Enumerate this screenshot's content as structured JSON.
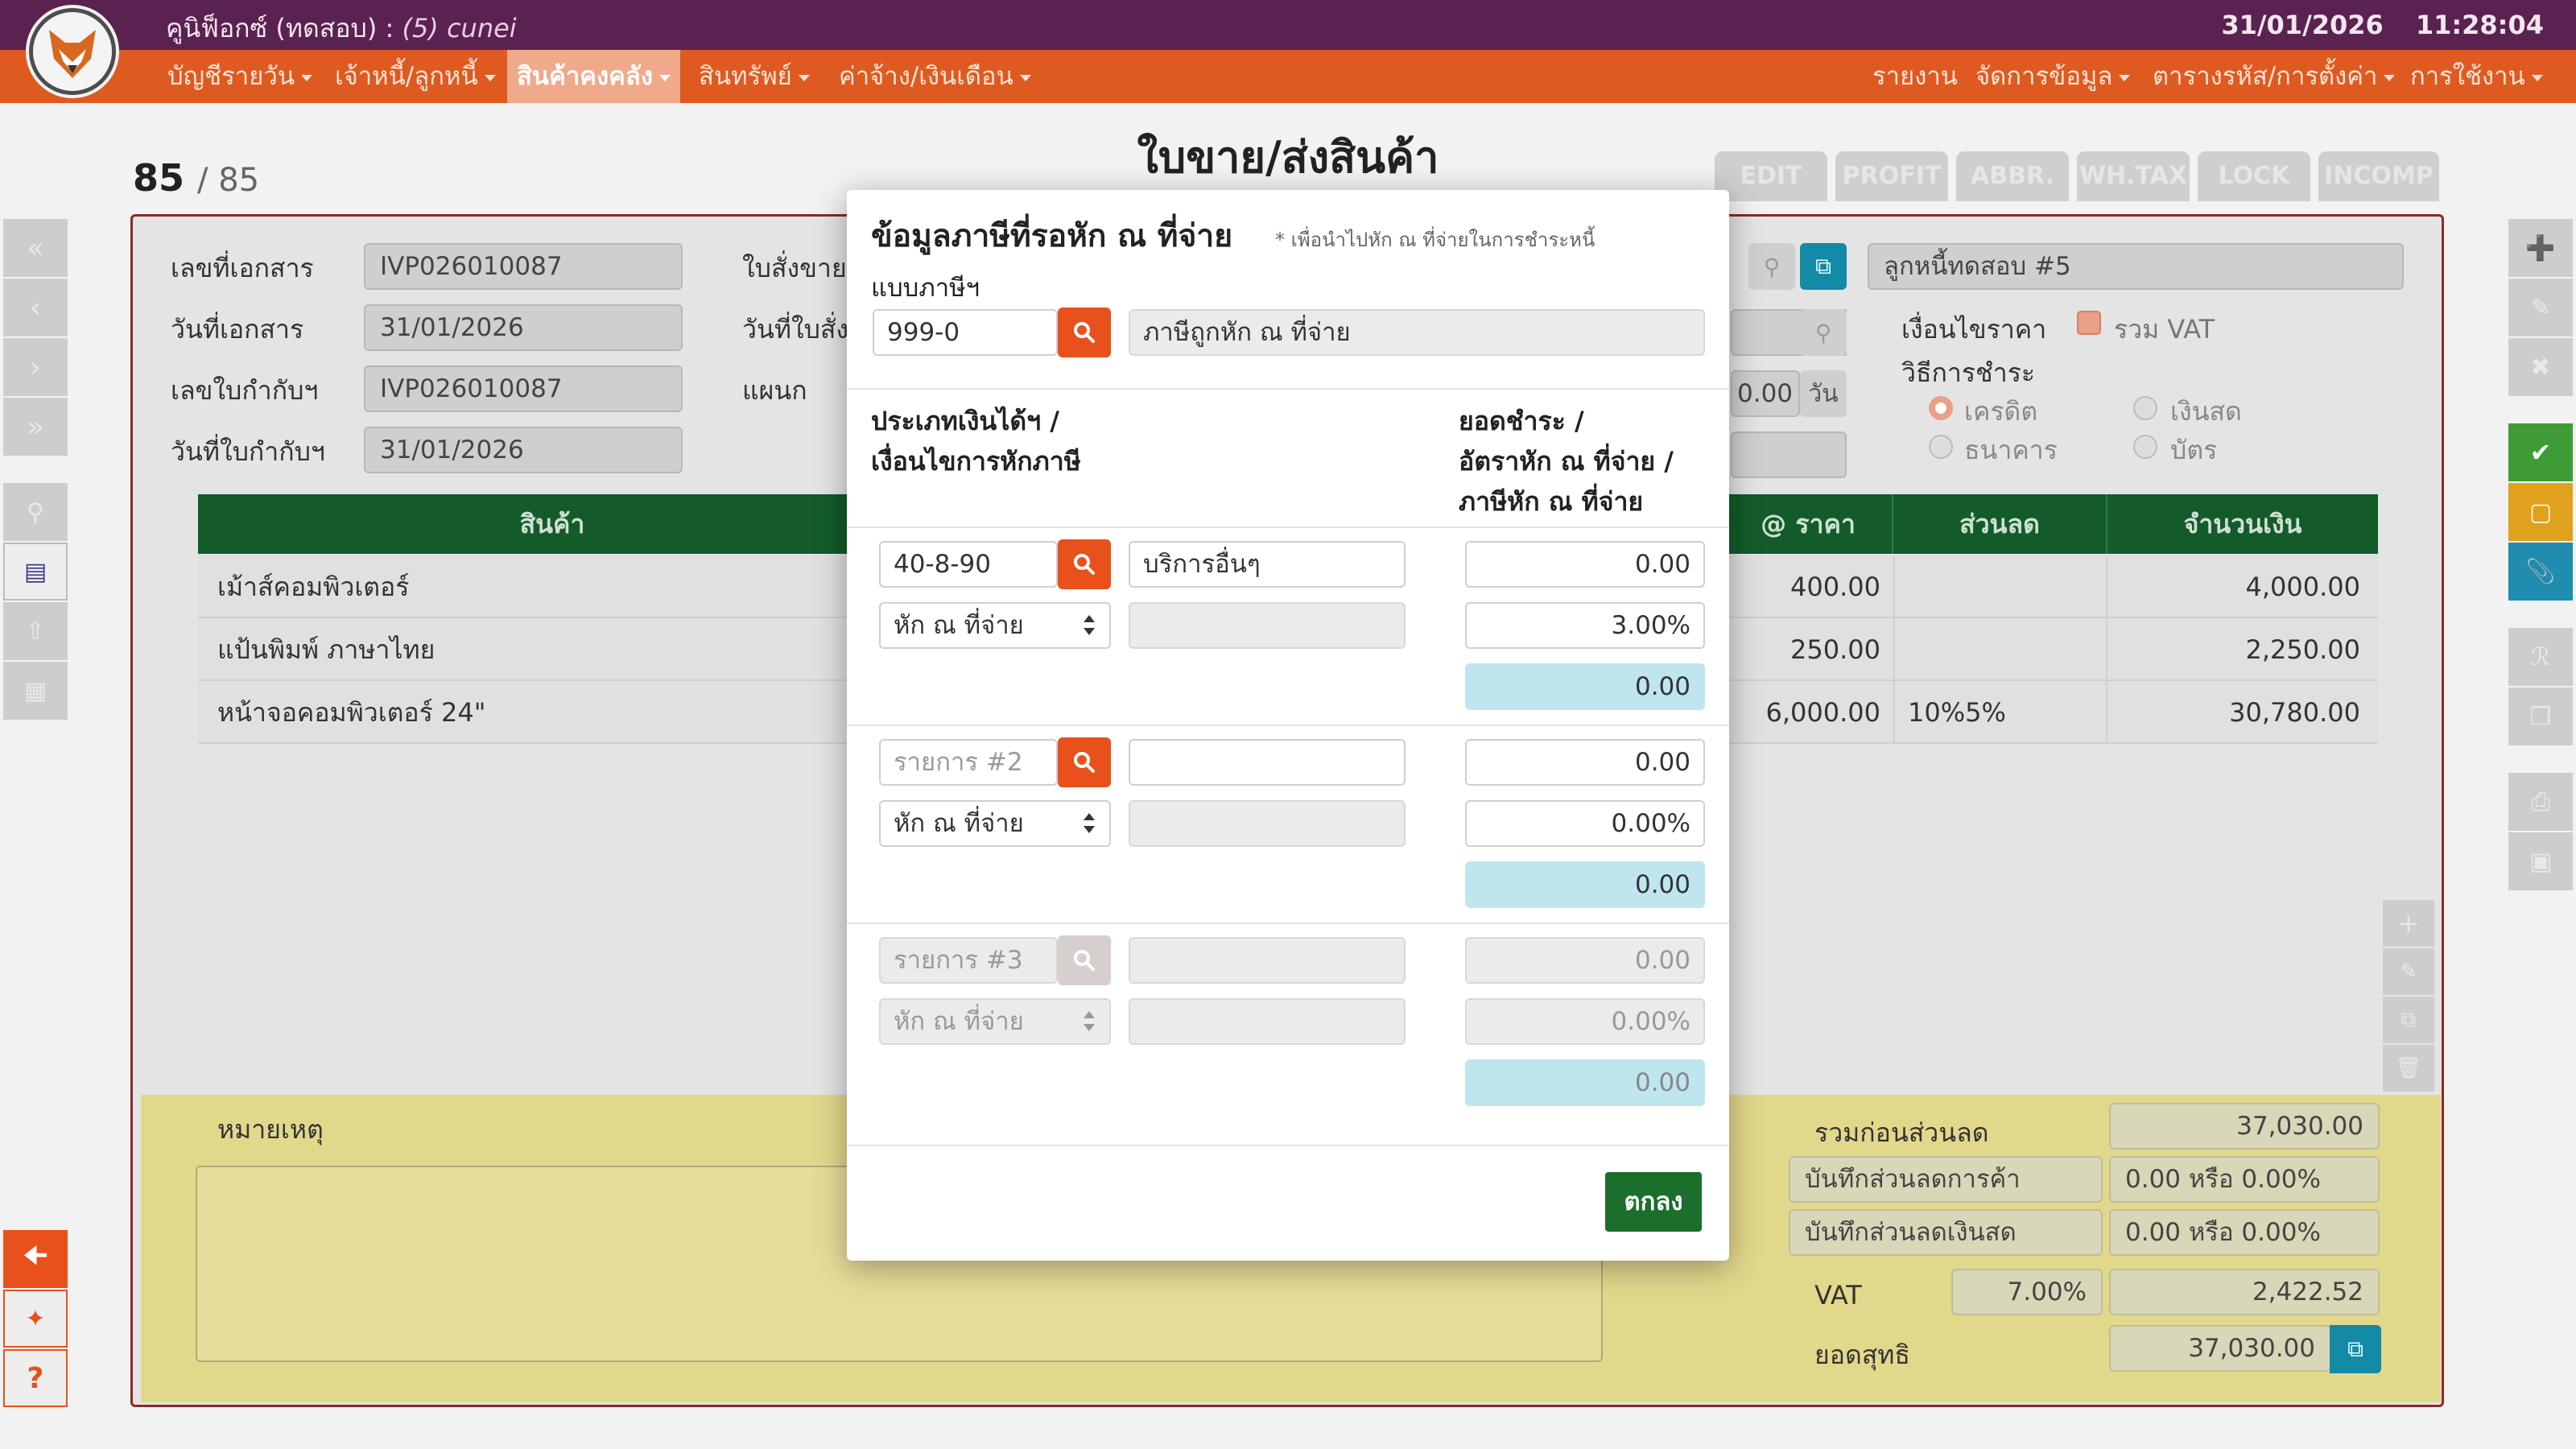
{
  "app": {
    "title": "คูนิฟ็อกซ์ (ทดสอบ)",
    "user_sep": " : ",
    "user": "(5) cunei",
    "date": "31/01/2026",
    "time": "11:28:04"
  },
  "menu": {
    "left": [
      "บัญชีรายวัน",
      "เจ้าหนี้/ลูกหนี้",
      "สินค้าคงคลัง",
      "สินทรัพย์",
      "ค่าจ้าง/เงินเดือน"
    ],
    "right": [
      "รายงาน",
      "จัดการข้อมูล",
      "ตารางรหัส/การตั้งค่า",
      "การใช้งาน"
    ]
  },
  "page": {
    "title": "ใบขาย/ส่งสินค้า",
    "counter": "85",
    "counter_total": "/ 85",
    "tags": [
      "EDIT",
      "PROFIT",
      "ABBR.",
      "WH.TAX",
      "LOCK",
      "INCOMP"
    ]
  },
  "form": {
    "doc_no_label": "เลขที่เอกสาร",
    "doc_no": "IVP026010087",
    "doc_date_label": "วันที่เอกสาร",
    "doc_date": "31/01/2026",
    "tax_no_label": "เลขใบกำกับฯ",
    "tax_no": "IVP026010087",
    "tax_date_label": "วันที่ใบกำกับฯ",
    "tax_date": "31/01/2026",
    "order_label": "ใบสั่งขาย",
    "order_date_label": "วันที่ใบสั่ง",
    "dept_label": "แผนก",
    "credit_days": "0.00",
    "day_unit": "วัน",
    "customer": "ลูกหนี้ทดสอบ #5",
    "price_cond_label": "เงื่อนไขราคา",
    "vat_incl": "รวม VAT",
    "pay_method_label": "วิธีการชำระ",
    "pay_options": [
      "เครดิต",
      "เงินสด",
      "ธนาคาร",
      "บัตร"
    ]
  },
  "table": {
    "headers": {
      "product": "สินค้า",
      "price": "@ ราคา",
      "discount": "ส่วนลด",
      "amount": "จำนวนเงิน"
    },
    "rows": [
      {
        "product": "เม้าส์คอมพิวเตอร์",
        "price": "400.00",
        "discount": "",
        "amount": "4,000.00"
      },
      {
        "product": "แป้นพิมพ์ ภาษาไทย",
        "price": "250.00",
        "discount": "",
        "amount": "2,250.00"
      },
      {
        "product": "หน้าจอคอมพิวเตอร์ 24\"",
        "price": "6,000.00",
        "discount": "10%5%",
        "amount": "30,780.00"
      }
    ]
  },
  "footer": {
    "notes_label": "หมายเหตุ",
    "subtotal_label": "รวมก่อนส่วนลด",
    "subtotal": "37,030.00",
    "trade_disc_label": "บันทึกส่วนลดการค้า",
    "trade_disc": "0.00 หรือ 0.00%",
    "cash_disc_label": "บันทึกส่วนลดเงินสด",
    "cash_disc": "0.00 หรือ 0.00%",
    "vat_label": "VAT",
    "vat_rate": "7.00%",
    "vat_amount": "2,422.52",
    "net_label": "ยอดสุทธิ",
    "net": "37,030.00"
  },
  "modal": {
    "title": "ข้อมูลภาษีที่รอหัก ณ ที่จ่าย",
    "note": "* เพื่อนำไปหัก ณ ที่จ่ายในการชำระหนี้",
    "form_label": "แบบภาษีฯ",
    "form_code": "999-0",
    "form_name": "ภาษีถูกหัก ณ ที่จ่าย",
    "col1_header": [
      "ประเภทเงินได้ฯ /",
      "เงื่อนไขการหักภาษี"
    ],
    "col2_header": [
      "ยอดชำระ /",
      "อัตราหัก ณ ที่จ่าย /",
      "ภาษีหัก ณ ที่จ่าย"
    ],
    "items": [
      {
        "code": "40-8-90",
        "code_placeholder": "",
        "name": "บริการอื่นๆ",
        "condition": "หัก ณ ที่จ่าย",
        "amount": "0.00",
        "rate": "3.00%",
        "tax": "0.00"
      },
      {
        "code": "",
        "code_placeholder": "รายการ #2",
        "name": "",
        "condition": "หัก ณ ที่จ่าย",
        "amount": "0.00",
        "rate": "0.00%",
        "tax": "0.00"
      },
      {
        "code": "",
        "code_placeholder": "รายการ #3",
        "name": "",
        "condition": "หัก ณ ที่จ่าย",
        "amount": "0.00",
        "rate": "0.00%",
        "tax": "0.00"
      }
    ],
    "ok": "ตกลง"
  },
  "colors": {
    "top": "#5a2250",
    "menu": "#df5a20",
    "accent": "#e8501c",
    "table_head": "#135c2a",
    "ok": "#1b6e2c",
    "teal": "#138aa6"
  }
}
